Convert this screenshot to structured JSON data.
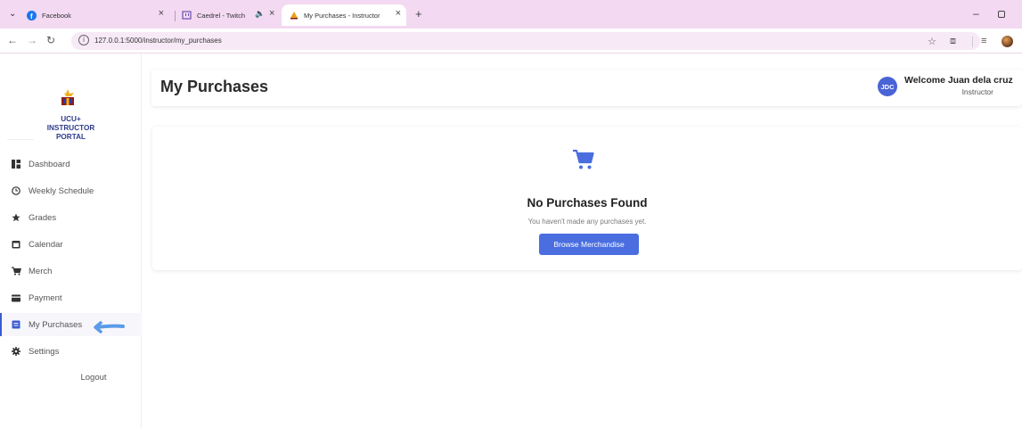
{
  "browser": {
    "tabs": [
      {
        "label": "Facebook",
        "icon": "facebook-icon",
        "active": false
      },
      {
        "label": "Caedrel - Twitch",
        "icon": "twitch-icon",
        "active": false
      },
      {
        "label": "My Purchases - Instructor",
        "icon": "site-logo-icon",
        "active": true
      }
    ],
    "url": "127.0.0.1:5000/instructor/my_purchases"
  },
  "sidebar": {
    "portal_title_lines": [
      "UCU+",
      "INSTRUCTOR",
      "PORTAL"
    ],
    "items": [
      {
        "label": "Dashboard",
        "icon": "dashboard-grid-icon"
      },
      {
        "label": "Weekly Schedule",
        "icon": "clock-icon"
      },
      {
        "label": "Grades",
        "icon": "star-icon"
      },
      {
        "label": "Calendar",
        "icon": "calendar-icon"
      },
      {
        "label": "Merch",
        "icon": "cart-icon"
      },
      {
        "label": "Payment",
        "icon": "credit-card-icon"
      },
      {
        "label": "My Purchases",
        "icon": "receipt-icon",
        "active": true
      },
      {
        "label": "Settings",
        "icon": "gear-icon"
      }
    ],
    "logout_label": "Logout"
  },
  "header": {
    "title": "My Purchases",
    "avatar_initials": "JDC",
    "welcome": "Welcome Juan dela cruz",
    "role": "Instructor"
  },
  "empty_state": {
    "icon": "shopping-cart-icon",
    "title": "No Purchases Found",
    "subtitle": "You haven't made any purchases yet.",
    "button_label": "Browse Merchandise"
  },
  "colors": {
    "tabbar": "#f3d9f2",
    "accent": "#4a6ee0",
    "portal_title": "#2f3d8c",
    "annotation_arrow": "#5b9be8"
  }
}
